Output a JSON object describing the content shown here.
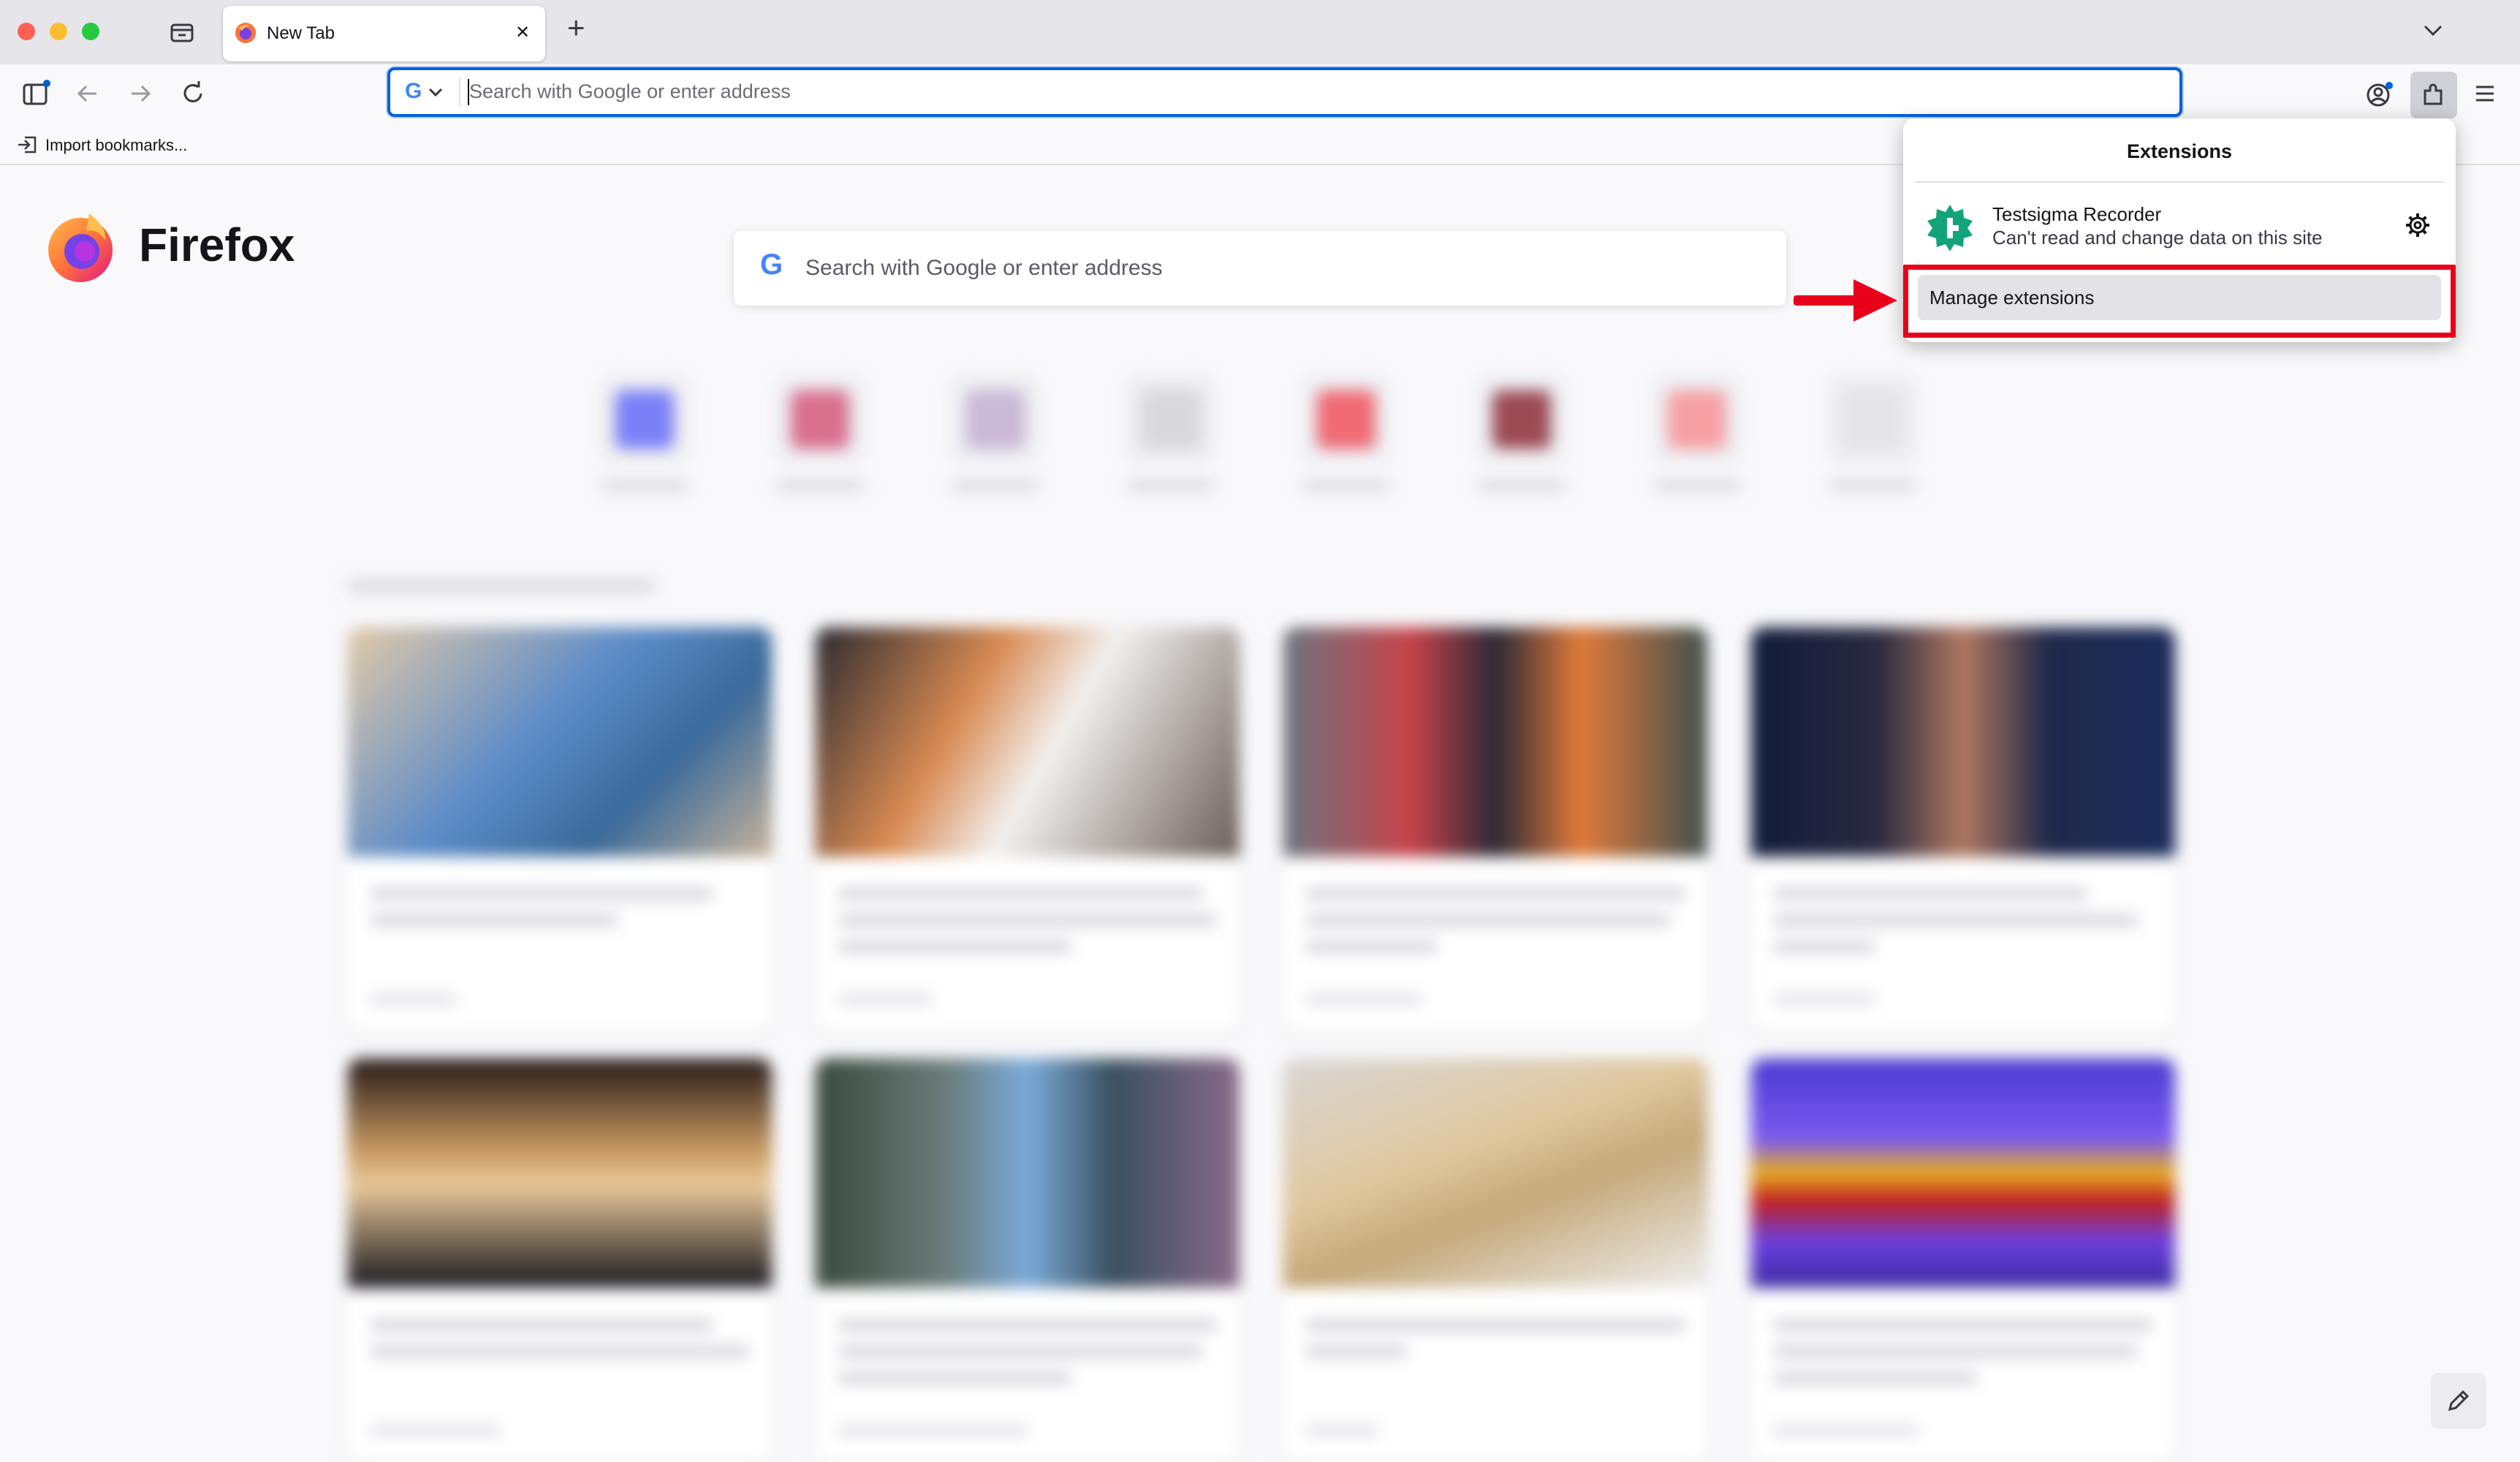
{
  "browser": {
    "tab": {
      "title": "New Tab",
      "close_glyph": "✕"
    },
    "new_tab_glyph": "+",
    "urlbar": {
      "placeholder": "Search with Google or enter address",
      "engine_icon": "google-g-icon"
    },
    "bookmarks_toolbar": {
      "import_label": "Import bookmarks..."
    }
  },
  "newtab": {
    "brand": "Firefox",
    "search_placeholder": "Search with Google or enter address"
  },
  "extensions_panel": {
    "title": "Extensions",
    "items": [
      {
        "name": "Testsigma Recorder",
        "description": "Can't read and change data on this site",
        "icon": "testsigma-icon"
      }
    ],
    "manage_label": "Manage extensions",
    "highlight_color": "#e8001a"
  },
  "colors": {
    "accent": "#0060df",
    "tabbar_bg": "#e6e6ea",
    "annotation_red": "#e8001a"
  }
}
